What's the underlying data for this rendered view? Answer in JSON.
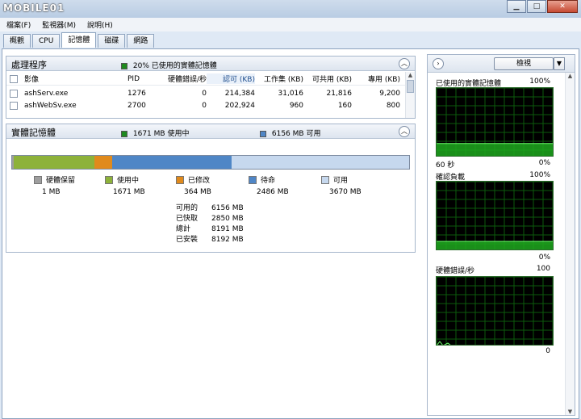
{
  "logo_text": "MOBILE01",
  "menu": [
    "檔案(F)",
    "監視器(M)",
    "說明(H)"
  ],
  "tabs": [
    "概觀",
    "CPU",
    "記憶體",
    "磁碟",
    "網路"
  ],
  "process_panel": {
    "title": "處理程序",
    "summary": "20% 已使用的實體記憶體",
    "summary_color": "#1e8a1e",
    "columns": [
      "影像",
      "PID",
      "硬體錯誤/秒",
      "認可 (KB)",
      "工作集 (KB)",
      "可共用 (KB)",
      "專用 (KB)"
    ],
    "rows": [
      {
        "name": "ashServ.exe",
        "pid": "1276",
        "faults": "0",
        "commit": "214,384",
        "ws": "31,016",
        "share": "21,816",
        "private": "9,200"
      },
      {
        "name": "ashWebSv.exe",
        "pid": "2700",
        "faults": "0",
        "commit": "202,924",
        "ws": "960",
        "share": "160",
        "private": "800"
      }
    ]
  },
  "memory_panel": {
    "title": "實體記憶體",
    "in_use_summary": "1671 MB 使用中",
    "available_summary": "6156 MB 可用",
    "bar_mb": {
      "reserved": 1,
      "in_use": 1671,
      "modified": 364,
      "standby": 2486,
      "free": 3670
    },
    "colors": {
      "reserved": "#9e9e9e",
      "in_use": "#8db23a",
      "modified": "#e08a1c",
      "standby": "#4f86c6",
      "free": "#c6d8ee"
    },
    "legend": [
      {
        "label": "硬體保留",
        "value": "1 MB"
      },
      {
        "label": "使用中",
        "value": "1671 MB"
      },
      {
        "label": "已修改",
        "value": "364 MB"
      },
      {
        "label": "待命",
        "value": "2486 MB"
      },
      {
        "label": "可用",
        "value": "3670 MB"
      }
    ],
    "stats": [
      {
        "k": "可用的",
        "v": "6156 MB"
      },
      {
        "k": "已快取",
        "v": "2850 MB"
      },
      {
        "k": "總計",
        "v": "8191 MB"
      },
      {
        "k": "已安裝",
        "v": "8192 MB"
      }
    ]
  },
  "right_panel": {
    "view_label": "檢視",
    "graphs": [
      {
        "title": "已使用的實體記憶體",
        "max": "100%",
        "foot_left": "60 秒",
        "foot_right": "0%",
        "level": 0.2
      },
      {
        "title": "確認負載",
        "max": "100%",
        "foot_left": "",
        "foot_right": "0%",
        "level": 0.14
      },
      {
        "title": "硬體錯誤/秒",
        "max": "100",
        "foot_left": "",
        "foot_right": "0",
        "level": 0.0
      }
    ]
  }
}
